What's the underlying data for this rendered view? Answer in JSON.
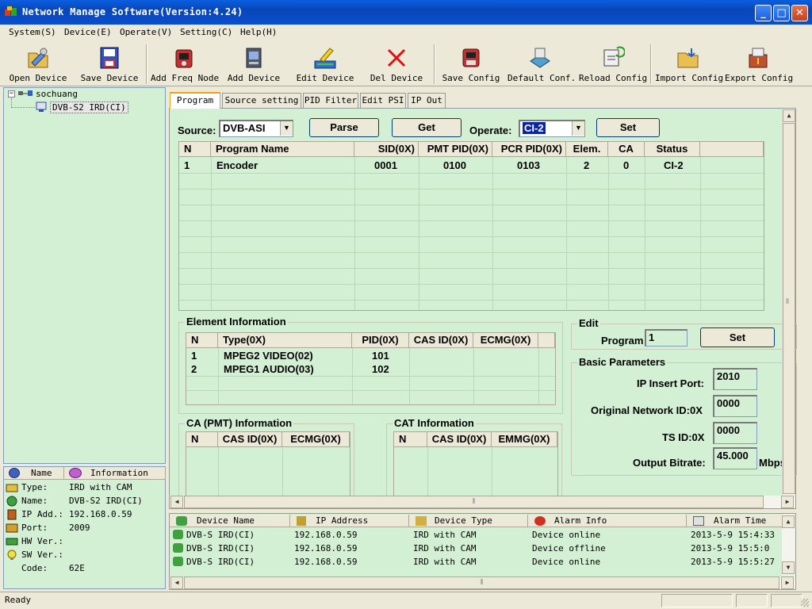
{
  "window": {
    "title": "Network Manage Software(Version:4.24)",
    "min": "_",
    "max": "□",
    "close": "✕"
  },
  "menu": [
    "System(S)",
    "Device(E)",
    "Operate(V)",
    "Setting(C)",
    "Help(H)"
  ],
  "toolbar": [
    {
      "label": "Open Device",
      "icon": "open-device-icon"
    },
    {
      "label": "Save Device",
      "icon": "save-device-icon"
    },
    {
      "label": "Add Freq Node",
      "icon": "add-freq-node-icon"
    },
    {
      "label": "Add Device",
      "icon": "add-device-icon"
    },
    {
      "label": "Edit Device",
      "icon": "edit-device-icon"
    },
    {
      "label": "Del Device",
      "icon": "delete-device-icon"
    },
    {
      "label": "Save Config",
      "icon": "save-config-icon"
    },
    {
      "label": "Default Conf.",
      "icon": "default-config-icon"
    },
    {
      "label": "Reload Config",
      "icon": "reload-config-icon"
    },
    {
      "label": "Import Config",
      "icon": "import-config-icon"
    },
    {
      "label": "Export Config",
      "icon": "export-config-icon"
    }
  ],
  "tree": {
    "root": "sochuang",
    "child": "DVB-S2 IRD(CI)",
    "expander": "−"
  },
  "info": {
    "headers": [
      "Name",
      "Information"
    ],
    "rows": [
      {
        "name": "Type:",
        "value": "IRD with CAM"
      },
      {
        "name": "Name:",
        "value": "DVB-S2 IRD(CI)"
      },
      {
        "name": "IP Add.:",
        "value": "192.168.0.59"
      },
      {
        "name": "Port:",
        "value": "2009"
      },
      {
        "name": "HW Ver.:",
        "value": ""
      },
      {
        "name": "SW Ver.:",
        "value": ""
      },
      {
        "name": "Code:",
        "value": "62E"
      }
    ]
  },
  "tabs": [
    "Program",
    "Source setting",
    "PID Filter",
    "Edit PSI",
    "IP Out"
  ],
  "controls": {
    "source_label": "Source:",
    "source_value": "DVB-ASI",
    "parse": "Parse",
    "get": "Get",
    "operate_label": "Operate:",
    "operate_value": "CI-2",
    "set": "Set"
  },
  "program_table": {
    "headers": [
      "N",
      "Program Name",
      "SID(0X)",
      "PMT PID(0X)",
      "PCR PID(0X)",
      "Elem.",
      "CA",
      "Status"
    ],
    "rows": [
      [
        "1",
        "Encoder",
        "0001",
        "0100",
        "0103",
        "2",
        "0",
        "CI-2"
      ]
    ]
  },
  "element_info": {
    "title": "Element Information",
    "headers": [
      "N",
      "Type(0X)",
      "PID(0X)",
      "CAS ID(0X)",
      "ECMG(0X)"
    ],
    "rows": [
      [
        "1",
        "MPEG2 VIDEO(02)",
        "101",
        "",
        ""
      ],
      [
        "2",
        "MPEG1 AUDIO(03)",
        "102",
        "",
        ""
      ]
    ]
  },
  "edit": {
    "title": "Edit",
    "program_label": "Program",
    "program_value": "1",
    "set": "Set"
  },
  "basic": {
    "title": "Basic Parameters",
    "ip_port_label": "IP Insert Port:",
    "ip_port": "2010",
    "onid_label": "Original Network ID:0X",
    "onid": "0000",
    "tsid_label": "TS ID:0X",
    "tsid": "0000",
    "bitrate_label": "Output Bitrate:",
    "bitrate": "45.000",
    "bitrate_unit": "Mbps"
  },
  "ca_pmt": {
    "title": "CA (PMT) Information",
    "headers": [
      "N",
      "CAS ID(0X)",
      "ECMG(0X)"
    ]
  },
  "cat": {
    "title": "CAT Information",
    "headers": [
      "N",
      "CAS ID(0X)",
      "EMMG(0X)"
    ]
  },
  "alarm": {
    "headers": [
      "Device Name",
      "IP Address",
      "Device Type",
      "Alarm Info",
      "Alarm Time"
    ],
    "rows": [
      [
        "DVB-S IRD(CI)",
        "192.168.0.59",
        "IRD with CAM",
        "Device online",
        "2013-5-9 15:4:33"
      ],
      [
        "DVB-S IRD(CI)",
        "192.168.0.59",
        "IRD with CAM",
        "Device offline",
        "2013-5-9 15:5:0"
      ],
      [
        "DVB-S IRD(CI)",
        "192.168.0.59",
        "IRD with CAM",
        "Device online",
        "2013-5-9 15:5:27"
      ]
    ]
  },
  "status": {
    "text": "Ready"
  },
  "scroll": {
    "up": "▲",
    "down": "▼",
    "left": "◀",
    "right": "▶",
    "grip": "⦀",
    "dropdown": "▼"
  },
  "colors": {
    "panel": "#d4f0d4",
    "titlebar": "#0a4ed0",
    "selection": "#0a24a8"
  }
}
